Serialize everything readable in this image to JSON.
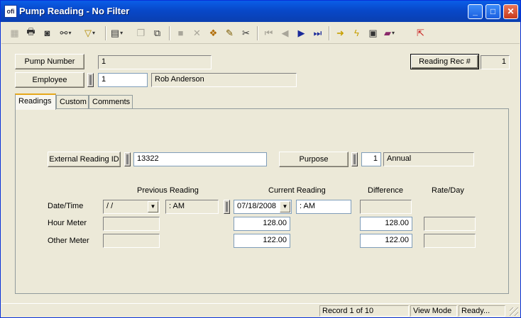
{
  "window": {
    "title": "Pump Reading - No Filter",
    "app_icon": "ofi"
  },
  "titlebar_buttons": {
    "minimize": "_",
    "maximize": "□",
    "close": "✕"
  },
  "toolbar": {
    "icons": [
      "grid-icon",
      "print-icon",
      "print-preview-icon",
      "binoculars-icon",
      "filter-icon",
      "new-record-icon",
      "copy-record-icon",
      "duplicate-icon",
      "save-icon",
      "delete-icon",
      "attach-icon",
      "edit-icon",
      "cut-icon",
      "first-record-icon",
      "previous-record-icon",
      "next-record-icon",
      "last-record-icon",
      "go-icon",
      "lightning-icon",
      "report-icon",
      "books-icon",
      "exit-icon"
    ]
  },
  "header": {
    "pump_number_label": "Pump Number",
    "pump_number_value": "1",
    "employee_label": "Employee",
    "employee_id": "1",
    "employee_name": "Rob Anderson",
    "reading_rec_label": "Reading Rec #",
    "reading_rec_value": "1"
  },
  "tabs": [
    {
      "label": "Readings",
      "active": true
    },
    {
      "label": "Custom",
      "active": false
    },
    {
      "label": "Comments",
      "active": false
    }
  ],
  "readings": {
    "external_reading_id_label": "External Reading ID",
    "external_reading_id_value": "13322",
    "purpose_label": "Purpose",
    "purpose_code": "1",
    "purpose_name": "Annual",
    "col_previous": "Previous Reading",
    "col_current": "Current Reading",
    "col_difference": "Difference",
    "col_rate": "Rate/Day",
    "row_datetime": "Date/Time",
    "row_hour_meter": "Hour Meter",
    "row_other_meter": "Other Meter",
    "prev_date": " / /",
    "prev_time": ":  AM",
    "curr_date": "07/18/2008",
    "curr_time": ":  AM",
    "prev_hour": "",
    "curr_hour": "128.00",
    "diff_hour": "128.00",
    "rate_hour": "",
    "prev_other": "",
    "curr_other": "122.00",
    "diff_other": "122.00",
    "rate_other": "",
    "diff_datetime": ""
  },
  "status": {
    "record": "Record 1 of 10",
    "mode": "View Mode",
    "state": "Ready..."
  }
}
